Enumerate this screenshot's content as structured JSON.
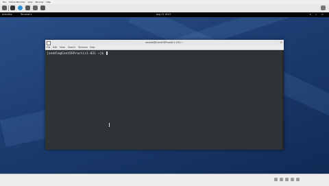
{
  "host": {
    "menu": [
      "File",
      "Virtual Machine",
      "View",
      "Window",
      "Help"
    ]
  },
  "gnome": {
    "activities": "Activities",
    "app_menu": "Terminal ▾",
    "clock": "Aug 13  18:47"
  },
  "terminal": {
    "title": "zeddle@CentOSPractic1-031:~",
    "menu": [
      "File",
      "Edit",
      "View",
      "Search",
      "Terminal",
      "Help"
    ],
    "prompt": "[zeddle@CentOSPractic1-031 ~]$ "
  },
  "colors": {
    "desktop": "#1c3c70",
    "terminal_bg": "#2e3436",
    "titlebar": "#e6e6e6"
  }
}
